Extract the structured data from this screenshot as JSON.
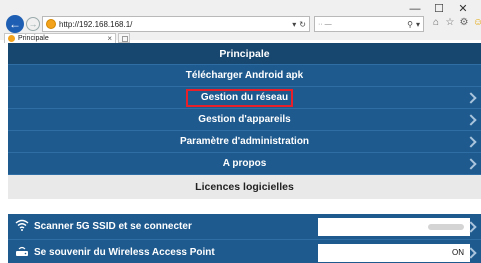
{
  "browser": {
    "url": "http://192.168.168.1/",
    "search_placeholder": "·· —",
    "tab_title": "Principale",
    "controls": {
      "minimize": "—",
      "maximize": "☐",
      "close": "✕"
    }
  },
  "menu": {
    "header": "Principale",
    "items": [
      {
        "label": "Télécharger Android apk"
      },
      {
        "label": "Gestion du réseau"
      },
      {
        "label": "Gestion d'appareils"
      },
      {
        "label": "Paramètre d'administration"
      },
      {
        "label": "A propos"
      }
    ],
    "licence": "Licences logicielles"
  },
  "settings": [
    {
      "label": "Scanner 5G SSID et se connecter",
      "value": "",
      "icon": "wifi-icon"
    },
    {
      "label": "Se souvenir du Wireless Access Point",
      "value": "ON",
      "icon": "router-icon"
    }
  ],
  "colors": {
    "menu_blue": "#1e5a8e",
    "header_blue": "#17466f",
    "highlight": "#e8202a"
  }
}
